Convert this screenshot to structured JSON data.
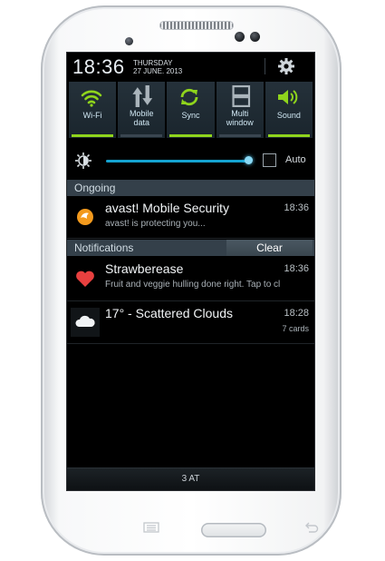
{
  "status": {
    "time": "18:36",
    "day": "THURSDAY",
    "date": "27 JUNE. 2013"
  },
  "toggles": [
    {
      "label": "Wi-Fi",
      "icon": "wifi-icon",
      "on": true
    },
    {
      "label": "Mobile\ndata",
      "icon": "mobile-data-icon",
      "on": false
    },
    {
      "label": "Sync",
      "icon": "sync-icon",
      "on": true
    },
    {
      "label": "Multi\nwindow",
      "icon": "multi-window-icon",
      "on": false
    },
    {
      "label": "Sound",
      "icon": "sound-icon",
      "on": true
    }
  ],
  "brightness": {
    "auto_label": "Auto",
    "level": 0.95,
    "auto_checked": false
  },
  "ongoing": {
    "header": "Ongoing",
    "items": [
      {
        "title": "avast! Mobile Security",
        "subtitle": "avast! is protecting you...",
        "time": "18:36",
        "icon": "avast-icon"
      }
    ]
  },
  "notifications": {
    "header": "Notifications",
    "clear_label": "Clear",
    "items": [
      {
        "title": "Strawberease",
        "subtitle": "Fruit and veggie hulling done right. Tap to cl",
        "time": "18:36",
        "icon": "heart-icon"
      },
      {
        "title": "17° - Scattered Clouds",
        "time": "18:28",
        "count": "7 cards",
        "icon": "cloud-icon"
      }
    ]
  },
  "carrier": "3 AT",
  "colors": {
    "accent_green": "#8fd41c",
    "accent_blue": "#15a3d1",
    "header_bg": "#34404a"
  }
}
